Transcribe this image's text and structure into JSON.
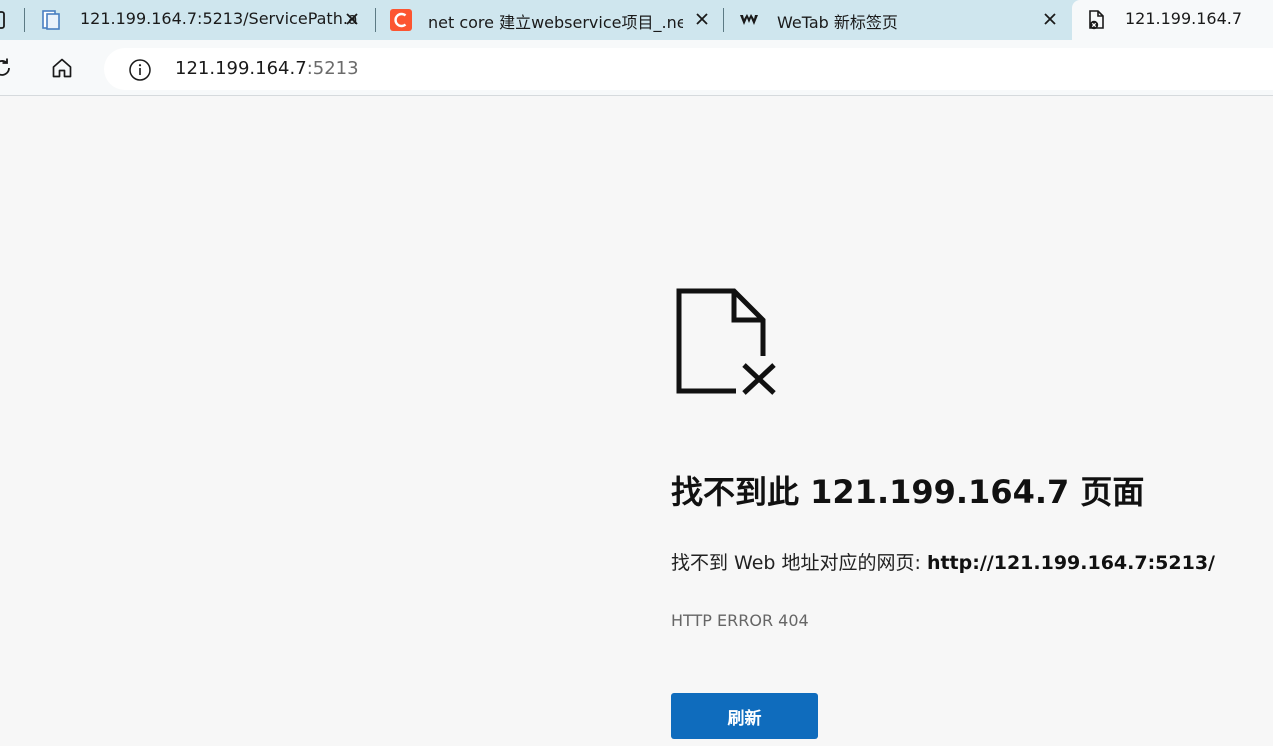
{
  "tabs": [
    {
      "title": "121.199.164.7:5213/ServicePath.a",
      "icon": "document-pages-icon"
    },
    {
      "title": "net core 建立webservice项目_.ne",
      "icon": "csdn-c-icon",
      "icon_color": "#fc5531"
    },
    {
      "title": "WeTab 新标签页",
      "icon": "wetab-logo-icon"
    },
    {
      "title": "121.199.164.7",
      "icon": "file-error-icon",
      "active": true
    }
  ],
  "address_bar": {
    "host": "121.199.164.7",
    "port": ":5213"
  },
  "error_page": {
    "title": "找不到此 121.199.164.7 页面",
    "description_prefix": "找不到 Web 地址对应的网页: ",
    "url": "http://121.199.164.7:5213/",
    "code": "HTTP ERROR 404",
    "refresh_label": "刷新"
  },
  "colors": {
    "tabstrip": "#cfe6ee",
    "refresh_button": "#0f6cbd"
  }
}
